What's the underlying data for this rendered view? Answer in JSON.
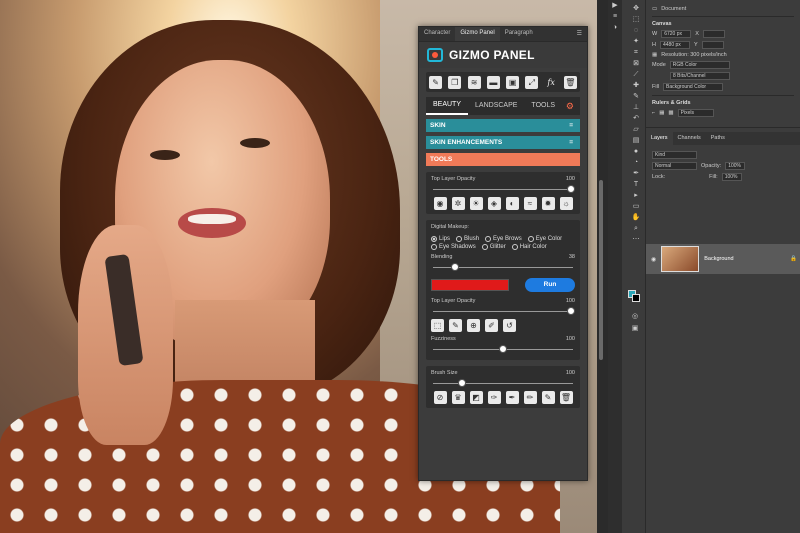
{
  "gizmo": {
    "tabs": [
      "Character",
      "Gizmo Panel",
      "Paragraph"
    ],
    "title": "GIZMO PANEL",
    "toolbar_icons": [
      "pencil-icon",
      "duplicate-icon",
      "layers-icon",
      "folder-icon",
      "new-doc-icon",
      "expand-icon",
      "fx-icon",
      "trash-icon"
    ],
    "fx_label": "fx",
    "nav_tabs": [
      "BEAUTY",
      "LANDSCAPE",
      "TOOLS"
    ],
    "sections": [
      {
        "label": "SKIN",
        "toggle": "="
      },
      {
        "label": "SKIN ENHANCEMENTS",
        "toggle": "="
      },
      {
        "label": "TOOLS",
        "toggle": ""
      }
    ],
    "opacity_box": {
      "label": "Top Layer Opacity",
      "value": "100",
      "level": 1.0
    },
    "makeup": {
      "label": "Digital Makeup:",
      "options": [
        "Lips",
        "Blush",
        "Eye Brows",
        "Eye Color",
        "Eye Shadows",
        "Glitter",
        "Hair Color"
      ],
      "selected": "Lips",
      "blending_label": "Blending",
      "blending_value": "38",
      "blending_level": 0.15,
      "swatch_color": "#e01a1a",
      "run_label": "Run",
      "opacity_label": "Top Layer Opacity",
      "opacity_value": "100",
      "opacity_level": 1.0,
      "fuzziness_label": "Fuzziness",
      "fuzziness_value": "100",
      "fuzziness_level": 0.5
    },
    "brush": {
      "label": "Brush Size",
      "value": "100",
      "level": 0.2
    }
  },
  "properties": {
    "document_label": "Document",
    "canvas_label": "Canvas",
    "width_label": "W",
    "width_value": "6720 px",
    "height_label": "H",
    "height_value": "4480 px",
    "x_label": "X",
    "y_label": "Y",
    "resolution": "Resolution: 300 pixels/inch",
    "mode_label": "Mode",
    "mode_value": "RGB Color",
    "bits_value": "8 Bits/Channel",
    "fill_label": "Fill",
    "fill_value": "Background Color",
    "rulers_label": "Rulers & Grids",
    "units_value": "Pixels"
  },
  "layers": {
    "tabs": [
      "Layers",
      "Channels",
      "Paths"
    ],
    "kind_label": "Kind",
    "blend_value": "Normal",
    "opacity_label": "Opacity:",
    "opacity_value": "100%",
    "lock_label": "Lock:",
    "fill_label": "Fill:",
    "fill_value": "100%",
    "layer_name": "Background"
  },
  "colors": {
    "teal": "#2a8e9a",
    "salmon": "#f07a58",
    "run": "#1e7be0",
    "accent": "#22b8d8"
  }
}
